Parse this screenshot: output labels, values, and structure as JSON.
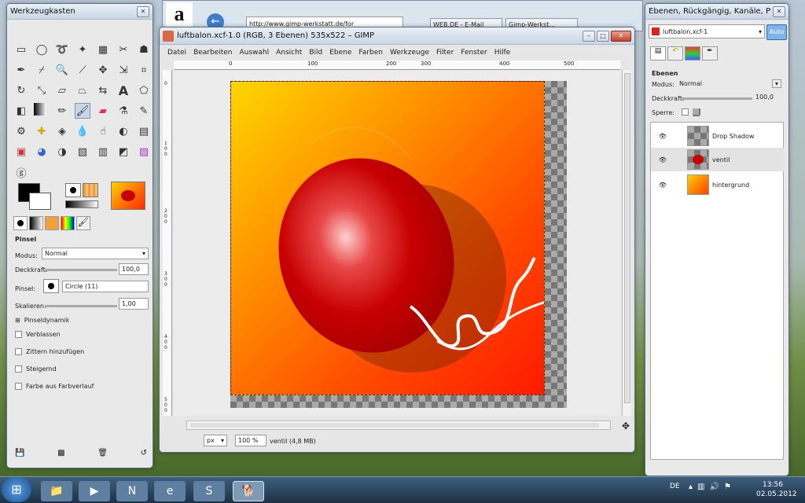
{
  "browser": {
    "url": "http://www.gimp-werkstatt.de/for",
    "tabs": [
      "WEB.DE - E-Mail",
      "Gimp-Werkst..."
    ],
    "amazon_logo": "a"
  },
  "toolbox": {
    "title": "Werkzeugkasten",
    "tool_options_title": "Pinsel",
    "mode_label": "Modus:",
    "mode_value": "Normal",
    "opacity_label": "Deckkraft:",
    "opacity_value": "100,0",
    "brush_label": "Pinsel:",
    "brush_value": "Circle (11)",
    "scale_label": "Skalieren:",
    "scale_value": "1,00",
    "dynamics_label": "Pinseldynamik",
    "checks": [
      "Verblassen",
      "Zittern hinzufügen",
      "Steigernd",
      "Farbe aus Farbverlauf"
    ]
  },
  "image_window": {
    "title": "luftbalon.xcf-1.0 (RGB, 3 Ebenen) 535x522 – GIMP",
    "menu": [
      "Datei",
      "Bearbeiten",
      "Auswahl",
      "Ansicht",
      "Bild",
      "Ebene",
      "Farben",
      "Werkzeuge",
      "Filter",
      "Fenster",
      "Hilfe"
    ],
    "ruler_top": [
      "0",
      "100",
      "200",
      "300",
      "400",
      "500"
    ],
    "ruler_left": [
      "0",
      "1 0 0",
      "2 0 0",
      "3 0 0",
      "4 0 0",
      "5 0 0"
    ],
    "unit": "px",
    "zoom": "100 %",
    "status": "ventil (4,8 MB)"
  },
  "layers_panel": {
    "title": "Ebenen, Rückgängig, Kanäle, Pfade",
    "image_select": "luftbalon.xcf-1",
    "auto_label": "Auto",
    "section_title": "Ebenen",
    "mode_label": "Modus:",
    "mode_value": "Normal",
    "opacity_label": "Deckkraft:",
    "opacity_value": "100,0",
    "lock_label": "Sperre:",
    "layers": [
      "Drop Shadow",
      "ventil",
      "hintergrund"
    ]
  },
  "taskbar": {
    "language": "DE",
    "time": "13:56",
    "date": "02.05.2012"
  }
}
